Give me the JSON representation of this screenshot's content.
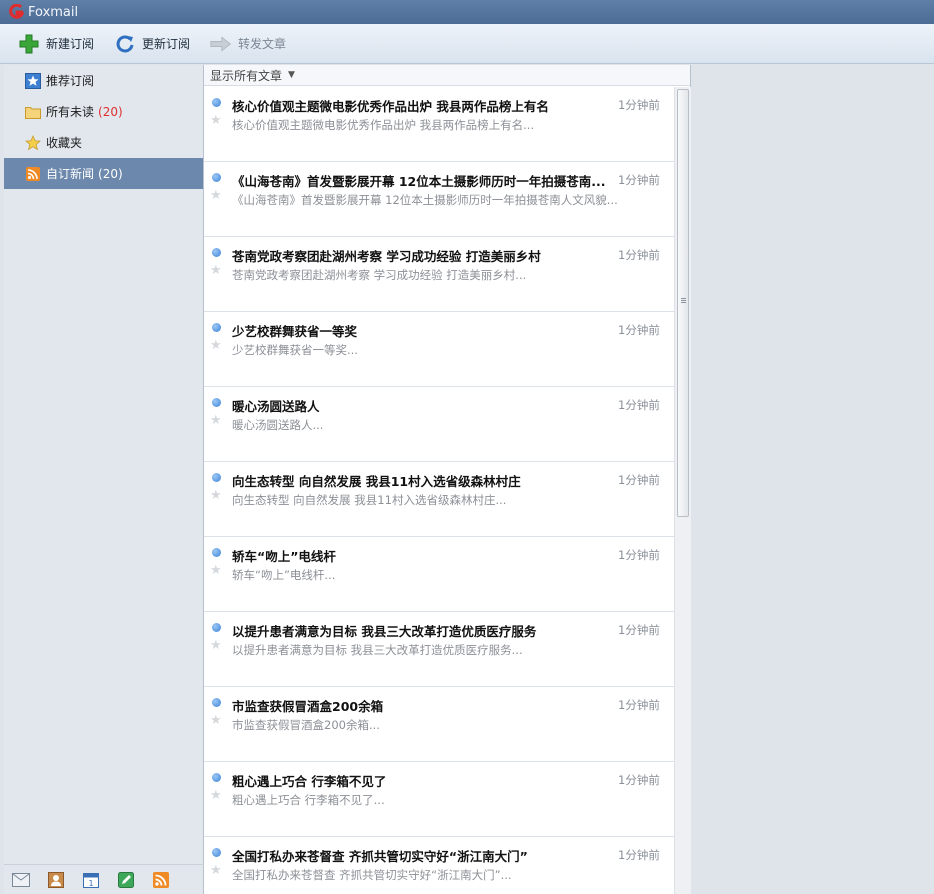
{
  "app": {
    "title": "Foxmail"
  },
  "toolbar": {
    "new_subscription": "新建订阅",
    "refresh_subscription": "更新订阅",
    "forward_article": "转发文章"
  },
  "sidebar": {
    "items": [
      {
        "label": "推荐订阅",
        "count": "",
        "icon": "star-box-icon"
      },
      {
        "label": "所有未读",
        "count": "(20)",
        "icon": "folder-icon"
      },
      {
        "label": "收藏夹",
        "count": "",
        "icon": "star-icon"
      },
      {
        "label": "自订新闻",
        "count": "(20)",
        "icon": "rss-icon"
      }
    ],
    "bottom_icons": [
      "mail-icon",
      "contacts-icon",
      "calendar-icon",
      "notes-icon",
      "rss-icon"
    ]
  },
  "list": {
    "filter_label": "显示所有文章",
    "articles": [
      {
        "title": "核心价值观主题微电影优秀作品出炉 我县两作品榜上有名",
        "snippet": "核心价值观主题微电影优秀作品出炉 我县两作品榜上有名...",
        "time": "1分钟前"
      },
      {
        "title": "《山海苍南》首发暨影展开幕 12位本土摄影师历时一年拍摄苍南...",
        "snippet": "《山海苍南》首发暨影展开幕 12位本土摄影师历时一年拍摄苍南人文风貌...",
        "time": "1分钟前"
      },
      {
        "title": "苍南党政考察团赴湖州考察 学习成功经验 打造美丽乡村",
        "snippet": "苍南党政考察团赴湖州考察 学习成功经验 打造美丽乡村...",
        "time": "1分钟前"
      },
      {
        "title": "少艺校群舞获省一等奖",
        "snippet": "少艺校群舞获省一等奖...",
        "time": "1分钟前"
      },
      {
        "title": "暖心汤圆送路人",
        "snippet": "暖心汤圆送路人...",
        "time": "1分钟前"
      },
      {
        "title": "向生态转型 向自然发展 我县11村入选省级森林村庄",
        "snippet": "向生态转型 向自然发展 我县11村入选省级森林村庄...",
        "time": "1分钟前"
      },
      {
        "title": "轿车“吻上”电线杆",
        "snippet": "轿车“吻上”电线杆...",
        "time": "1分钟前"
      },
      {
        "title": "以提升患者满意为目标 我县三大改革打造优质医疗服务",
        "snippet": "以提升患者满意为目标 我县三大改革打造优质医疗服务...",
        "time": "1分钟前"
      },
      {
        "title": "市监查获假冒酒盒200余箱",
        "snippet": "市监查获假冒酒盒200余箱...",
        "time": "1分钟前"
      },
      {
        "title": "粗心遇上巧合 行李箱不见了",
        "snippet": "粗心遇上巧合 行李箱不见了...",
        "time": "1分钟前"
      },
      {
        "title": "全国打私办来苍督查 齐抓共管切实守好“浙江南大门”",
        "snippet": "全国打私办来苍督查 齐抓共管切实守好“浙江南大门”...",
        "time": "1分钟前"
      }
    ]
  },
  "colors": {
    "accent": "#6c89ad",
    "unread_count": "#e03030",
    "unread_dot": "#3b82d6"
  }
}
